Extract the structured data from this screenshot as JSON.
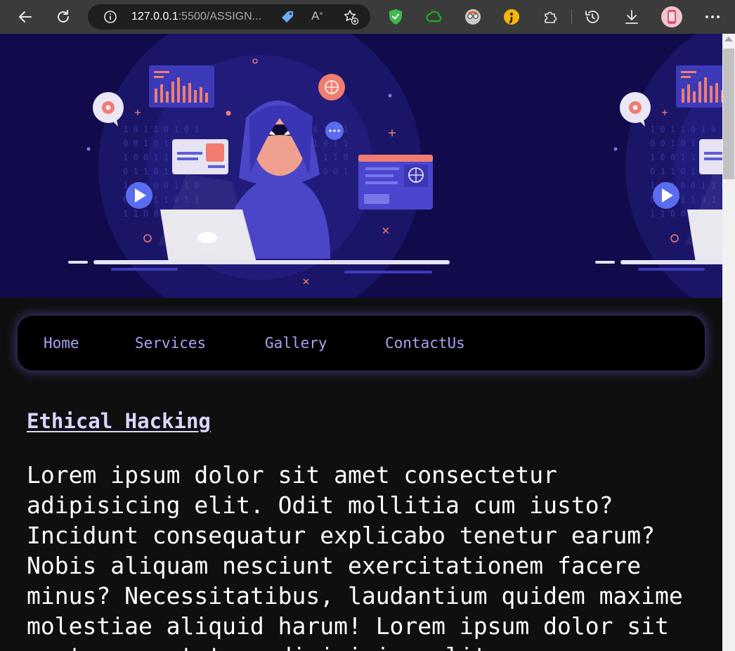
{
  "browser": {
    "url_host": "127.0.0.1",
    "url_rest": ":5500/ASSIGN...",
    "icons": [
      "back-arrow-icon",
      "refresh-icon",
      "info-icon",
      "tag-icon",
      "read-aloud-icon",
      "favorite-add-icon",
      "shield-extension-icon",
      "cloud-extension-icon",
      "avatar-extension-icon",
      "semicolon-extension-icon",
      "extensions-puzzle-icon",
      "history-icon",
      "download-icon",
      "profile-avatar",
      "more-menu-icon"
    ]
  },
  "colors": {
    "hero_bg": "#110b4b",
    "nav_text": "#a8a4f4",
    "heading": "#d9d6ff",
    "body_text": "#ffffff"
  },
  "nav": {
    "items": [
      {
        "label": "Home"
      },
      {
        "label": "Services"
      },
      {
        "label": "Gallery"
      },
      {
        "label": "ContactUs"
      }
    ]
  },
  "content": {
    "heading": "Ethical Hacking",
    "paragraph": "Lorem ipsum dolor sit amet consectetur adipisicing elit. Odit mollitia cum iusto? Incidunt consequatur explicabo tenetur earum? Nobis aliquam nesciunt exercitationem facere minus? Necessitatibus, laudantium quidem maxime molestiae aliquid harum! Lorem ipsum dolor sit amet consectetur adipisicing elit."
  }
}
